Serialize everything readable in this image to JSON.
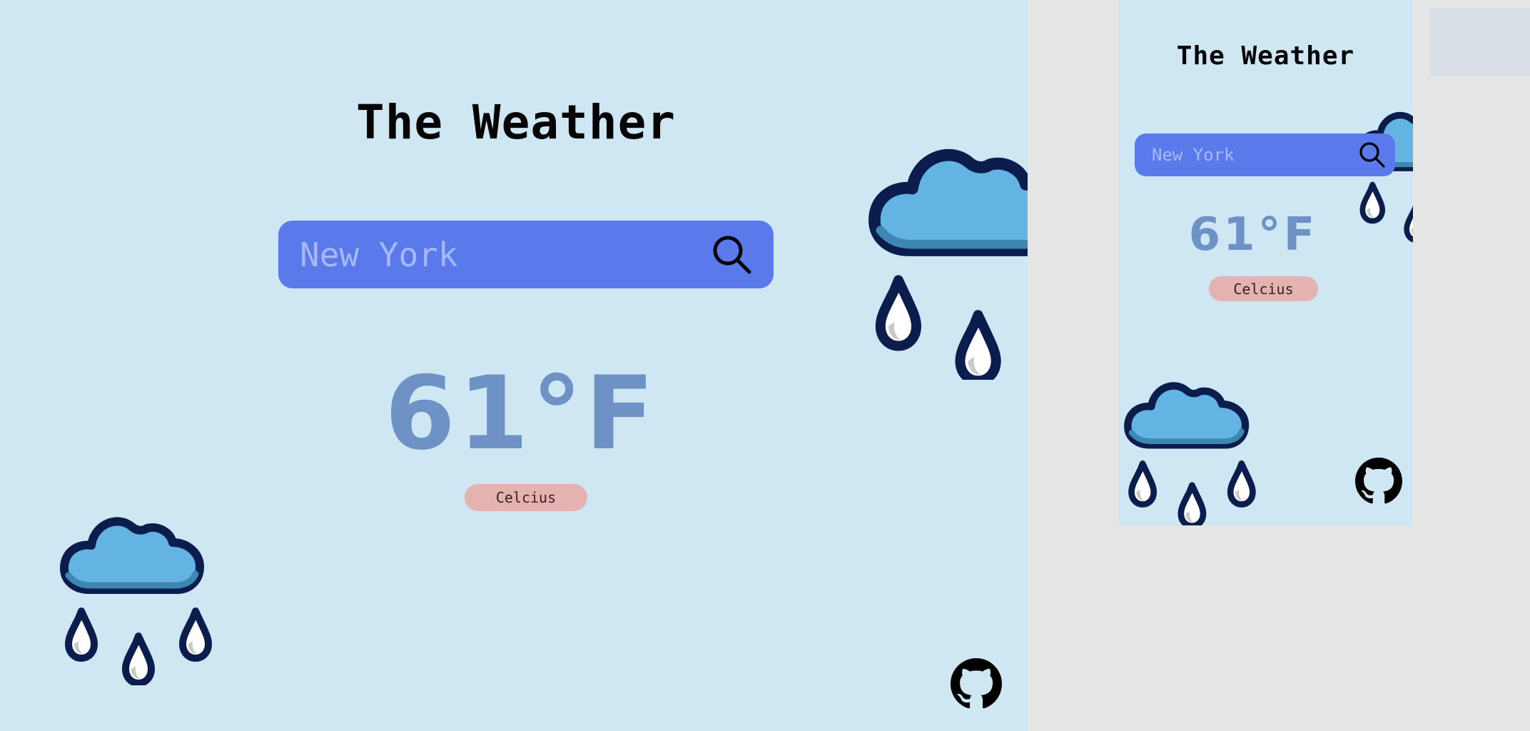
{
  "app": {
    "title": "The Weather",
    "search": {
      "value": "",
      "placeholder": "New York"
    },
    "temperature": "61°F",
    "unit_toggle_label": "Celcius"
  },
  "icons": {
    "search": "magnifier-icon",
    "weather": "rain-cloud-icon",
    "repo": "github-icon"
  },
  "colors": {
    "background": "#cfe7f3",
    "search_bar": "#5a7aec",
    "placeholder": "#a6b9f5",
    "temperature": "#6f92c6",
    "unit_toggle": "#e5b2b2",
    "cloud": "#63b4e3",
    "outline": "#0b1d4d"
  }
}
